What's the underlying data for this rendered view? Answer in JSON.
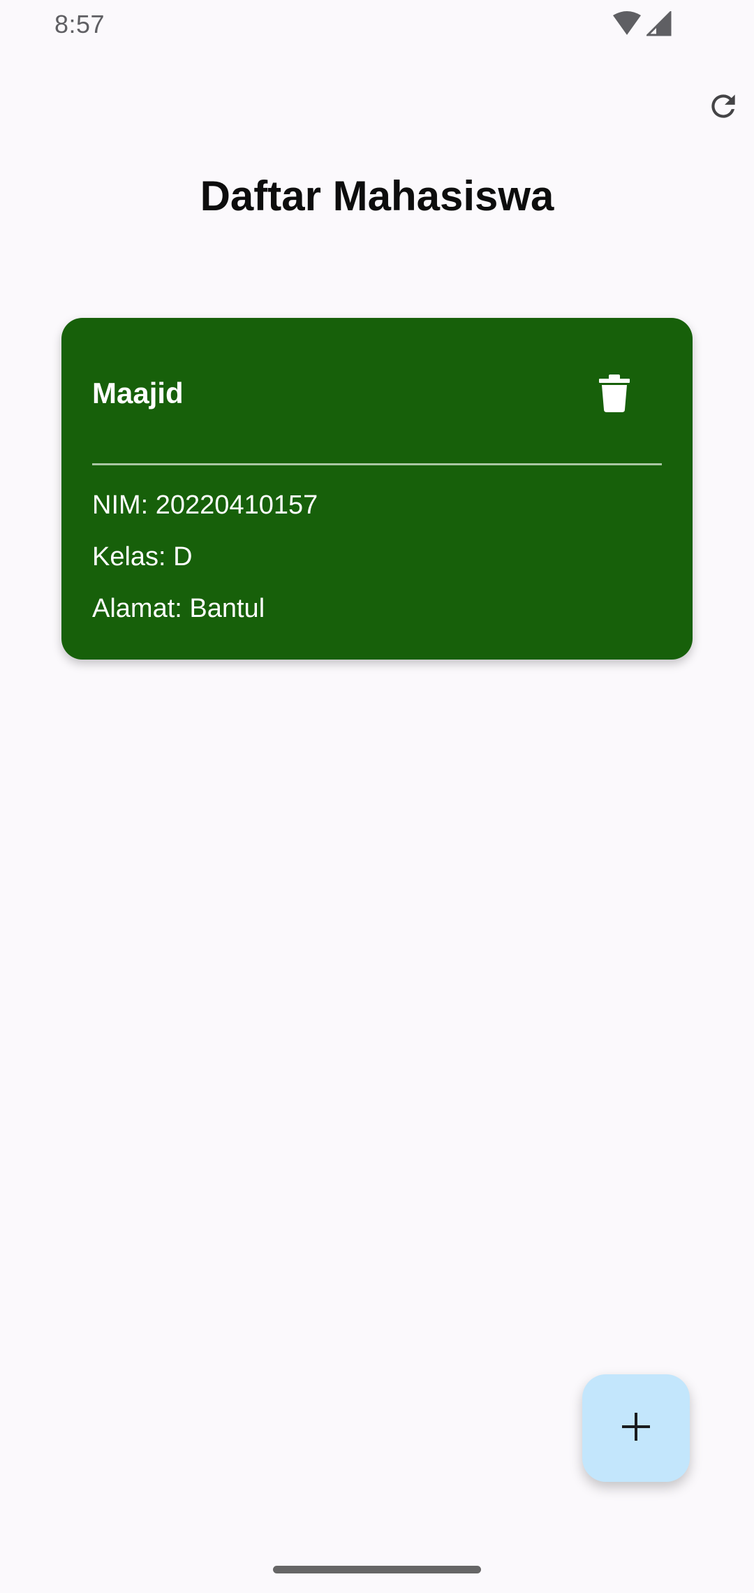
{
  "status_bar": {
    "time": "8:57",
    "icons": [
      "wifi-icon",
      "cellular-signal-icon"
    ]
  },
  "header": {
    "title": "Daftar Mahasiswa",
    "refresh_icon": "refresh-icon"
  },
  "students": [
    {
      "name": "Maajid",
      "nim": "NIM: 20220410157",
      "kelas": "Kelas: D",
      "alamat": "Alamat: Bantul",
      "delete_icon": "trash-icon"
    }
  ],
  "fab": {
    "icon": "plus-icon"
  },
  "colors": {
    "background": "#fbf9fc",
    "card": "#17600a",
    "card_text": "#ffffff",
    "fab": "#c3e6fc",
    "title": "#0d0d0d"
  }
}
